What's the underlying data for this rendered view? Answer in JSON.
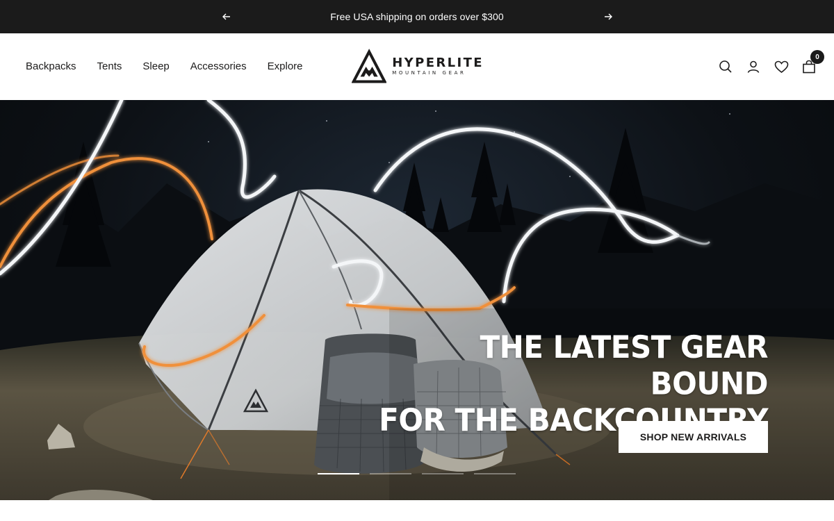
{
  "announcement": {
    "message": "Free USA shipping on orders over $300",
    "prev_icon": "arrow-left-icon",
    "next_icon": "arrow-right-icon"
  },
  "header": {
    "nav": [
      "Backpacks",
      "Tents",
      "Sleep",
      "Accessories",
      "Explore"
    ],
    "logo": {
      "name": "HYPERLITE",
      "sub": "MOUNTAIN GEAR"
    },
    "icons": [
      "search-icon",
      "account-icon",
      "wishlist-heart-icon",
      "cart-bag-icon"
    ],
    "cart_count": "0"
  },
  "hero": {
    "headline_line1": "THE LATEST GEAR BOUND",
    "headline_line2": "FOR THE BACKCOUNTRY",
    "cta_label": "SHOP NEW ARRIVALS",
    "slides": 4,
    "active_slide": 1
  },
  "colors": {
    "announcement_bg": "#1b1b1b",
    "text": "#1c1b1b",
    "light_trail_orange": "#f0903a",
    "light_trail_white": "#f4f6f8"
  }
}
